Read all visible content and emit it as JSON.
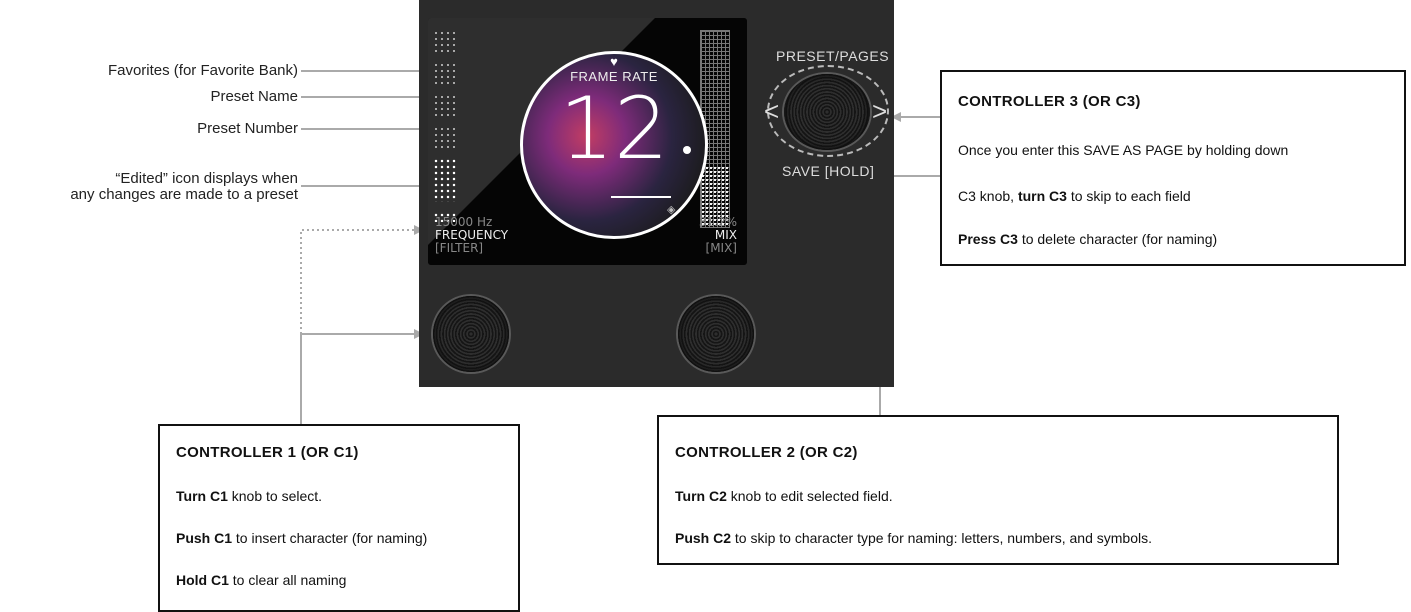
{
  "labels": {
    "favorites": "Favorites (for Favorite Bank)",
    "preset_name": "Preset Name",
    "preset_number": "Preset Number",
    "edited_line1": "“Edited” icon displays when",
    "edited_line2": "any changes are made to a preset"
  },
  "screen": {
    "preset_name": "FRAME RATE",
    "preset_number": "12",
    "heart_icon": "♥",
    "edited_icon": "◈",
    "left_param": {
      "value": "15000 Hz",
      "name": "FREQUENCY",
      "group": "[FILTER]"
    },
    "right_param": {
      "value": "31.2%",
      "name": "MIX",
      "group": "[MIX]"
    },
    "mix_level_percent": 31.2
  },
  "device": {
    "top_label": "PRESET/PAGES",
    "bottom_label": "SAVE [HOLD]",
    "left_chevron": "<",
    "right_chevron": ">"
  },
  "c3": {
    "title": "CONTROLLER 3 (OR C3)",
    "line1": "Once you enter this SAVE AS PAGE by holding down",
    "line2_pre": "C3 knob, ",
    "line2_bold": "turn C3",
    "line2_post": " to skip to each field",
    "line3_bold": "Press C3",
    "line3_post": " to delete character (for naming)"
  },
  "c1": {
    "title": "CONTROLLER 1 (OR C1)",
    "line1_bold": "Turn C1",
    "line1_post": " knob to select.",
    "line2_bold": "Push C1",
    "line2_post": " to insert character (for naming)",
    "line3_bold": "Hold C1",
    "line3_post": " to clear all naming"
  },
  "c2": {
    "title": "CONTROLLER 2 (OR C2)",
    "line1_bold": "Turn C2",
    "line1_post": " knob to edit selected field.",
    "line2_bold": "Push C2",
    "line2_post": " to skip to character type for naming:  letters, numbers, and symbols."
  },
  "colors": {
    "device": "#2b2b2b",
    "screen": "#111111",
    "connector": "#aaaaaa",
    "box_border": "#111111"
  },
  "icons": [
    "heart-icon",
    "edited-icon",
    "arrow-left-icon",
    "arrow-right-icon"
  ]
}
